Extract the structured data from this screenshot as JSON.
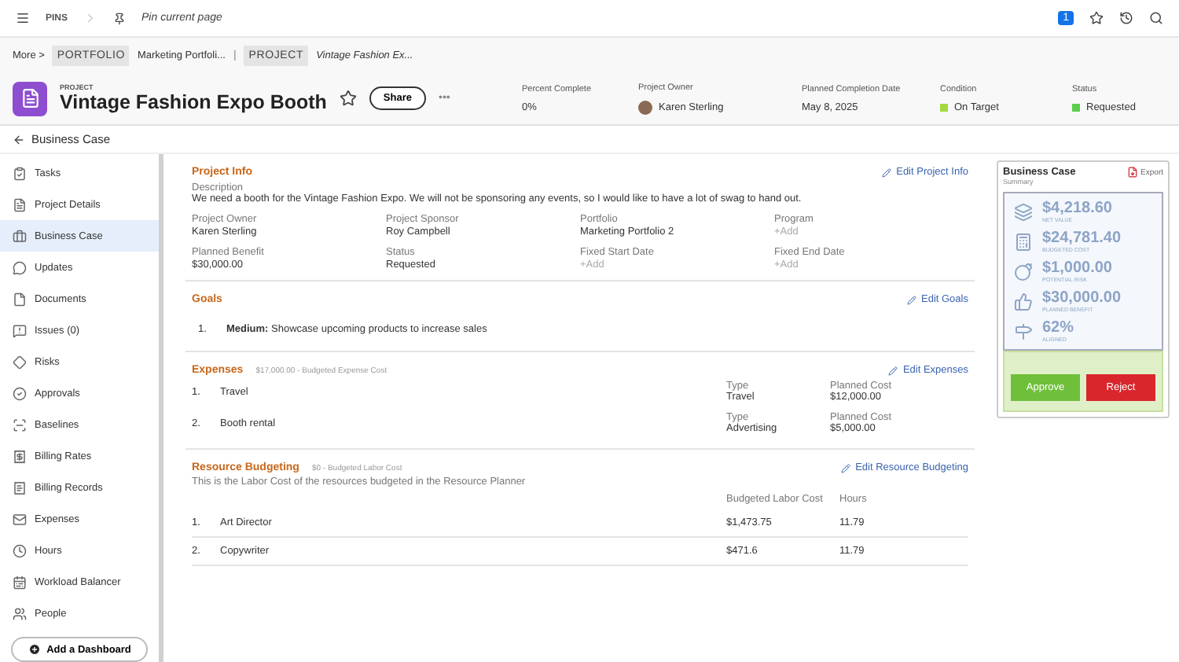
{
  "topbar": {
    "pins_label": "PINS",
    "pin_action": "Pin current page",
    "notification_count": "1"
  },
  "breadcrumbs": {
    "more": "More >",
    "separator": "|",
    "items": [
      {
        "tag": "PORTFOLIO",
        "name": "Marketing Portfoli..."
      },
      {
        "tag": "PROJECT",
        "name": "Vintage Fashion Ex..."
      }
    ]
  },
  "header": {
    "kicker": "PROJECT",
    "title": "Vintage Fashion Expo Booth",
    "favorite": false,
    "share": "Share",
    "more": "•••",
    "fields": [
      {
        "label": "Percent Complete",
        "value": "0%",
        "kind": "text"
      },
      {
        "label": "Project Owner",
        "value": "Karen Sterling",
        "kind": "person"
      },
      {
        "label": "Planned Completion Date",
        "value": "May 8, 2025",
        "kind": "text"
      },
      {
        "label": "Condition",
        "value": "On Target",
        "kind": "status",
        "color": "#a3d93f"
      },
      {
        "label": "Status",
        "value": "Requested",
        "kind": "status",
        "color": "#5ccf4e"
      }
    ]
  },
  "page_title": "Business Case",
  "sidebar": {
    "items": [
      {
        "label": "Tasks",
        "selected": false
      },
      {
        "label": "Project Details",
        "selected": false
      },
      {
        "label": "Business Case",
        "selected": true
      },
      {
        "label": "Updates",
        "selected": false
      },
      {
        "label": "Documents",
        "selected": false
      },
      {
        "label": "Issues (0)",
        "selected": false
      },
      {
        "label": "Risks",
        "selected": false
      },
      {
        "label": "Approvals",
        "selected": false
      },
      {
        "label": "Baselines",
        "selected": false
      },
      {
        "label": "Billing Rates",
        "selected": false
      },
      {
        "label": "Billing Records",
        "selected": false
      },
      {
        "label": "Expenses",
        "selected": false
      },
      {
        "label": "Hours",
        "selected": false
      },
      {
        "label": "Workload Balancer",
        "selected": false
      },
      {
        "label": "People",
        "selected": false
      }
    ],
    "add_button": "Add a Dashboard"
  },
  "project_info": {
    "title": "Project Info",
    "edit": "Edit Project Info",
    "description_label": "Description",
    "description": "We need a booth for the Vintage Fashion Expo. We will not be sponsoring any events, so I would like to have a lot of swag to hand out.",
    "fields": [
      {
        "label": "Project Owner",
        "value": "Karen Sterling",
        "empty": false
      },
      {
        "label": "Project Sponsor",
        "value": "Roy Campbell",
        "empty": false
      },
      {
        "label": "Portfolio",
        "value": "Marketing Portfolio 2",
        "empty": false
      },
      {
        "label": "Program",
        "value": "+Add",
        "empty": true
      },
      {
        "label": "Planned Benefit",
        "value": "$30,000.00",
        "empty": false
      },
      {
        "label": "Status",
        "value": "Requested",
        "empty": false
      },
      {
        "label": "Fixed Start Date",
        "value": "+Add",
        "empty": true
      },
      {
        "label": "Fixed End Date",
        "value": "+Add",
        "empty": true
      }
    ]
  },
  "goals": {
    "title": "Goals",
    "edit": "Edit Goals",
    "items": [
      {
        "number": "1.",
        "text": "**Medium:** Showcase upcoming products to increase sales"
      }
    ]
  },
  "expenses": {
    "title": "Expenses",
    "subtitle": "$17,000.00 - Budgeted Expense Cost",
    "edit": "Edit Expenses",
    "rows": [
      {
        "number": "1.",
        "name": "Travel",
        "type_label": "Type",
        "type": "Travel",
        "cost_label": "Planned Cost",
        "cost": "$12,000.00"
      },
      {
        "number": "2.",
        "name": "Booth rental",
        "type_label": "Type",
        "type": "Advertising",
        "cost_label": "Planned Cost",
        "cost": "$5,000.00"
      }
    ]
  },
  "resource_budgeting": {
    "title": "Resource Budgeting",
    "subtitle": "$0 - Budgeted Labor Cost",
    "edit": "Edit Resource Budgeting",
    "note": "This is the Labor Cost of the resources budgeted in the Resource Planner",
    "columns": [
      "Budgeted Labor Cost",
      "Hours"
    ],
    "rows": [
      {
        "number": "1.",
        "name": "Art Director",
        "cost": "$1,473.75",
        "hours": "11.79"
      },
      {
        "number": "2.",
        "name": "Copywriter",
        "cost": "$471.6",
        "hours": "11.79"
      }
    ]
  },
  "summary": {
    "title": "Business Case",
    "subtitle": "Summary",
    "export": "Export",
    "metrics": [
      {
        "value": "$4,218.60",
        "label": "NET VALUE"
      },
      {
        "value": "$24,781.40",
        "label": "BUDGETED COST"
      },
      {
        "value": "$1,000.00",
        "label": "POTENTIAL RISK"
      },
      {
        "value": "$30,000.00",
        "label": "PLANNED BENEFIT"
      },
      {
        "value": "62%",
        "label": "ALIGNED"
      }
    ],
    "approve": "Approve",
    "reject": "Reject"
  }
}
